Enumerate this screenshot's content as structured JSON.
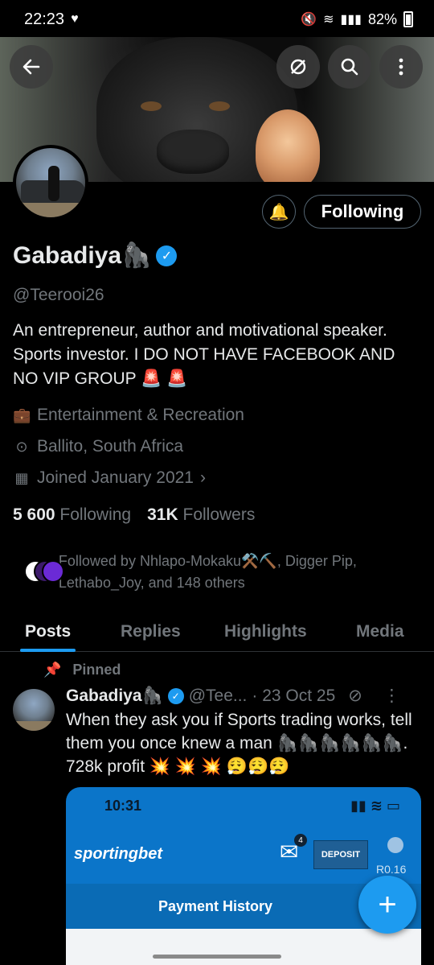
{
  "status_bar": {
    "time": "22:23",
    "battery": "82%",
    "signal_label": "Vo) LTE2"
  },
  "profile": {
    "display_name": "Gabadiya🦍",
    "handle": "@Teerooi26",
    "bio": "An entrepreneur, author and motivational speaker. Sports investor. I DO NOT HAVE FACEBOOK AND NO VIP GROUP 🚨 🚨",
    "category": "Entertainment & Recreation",
    "location": "Ballito, South Africa",
    "joined": "Joined January 2021",
    "following_count": "5 600",
    "following_label": "Following",
    "followers_count": "31K",
    "followers_label": "Followers",
    "followed_by": "Followed by Nhlapo-Mokaku⚒️⛏️, Digger Pip, Lethabo_Joy, and 148 others",
    "follow_button": "Following"
  },
  "tabs": [
    "Posts",
    "Replies",
    "Highlights",
    "Media"
  ],
  "pinned_label": "Pinned",
  "tweet": {
    "name": "Gabadiya🦍",
    "handle": "@Tee...",
    "date": "· 23 Oct 25",
    "text": "When they ask you if Sports trading works, tell them you once knew a man 🦍🦍🦍🦍🦍🦍. 728k profit 💥 💥 💥 😮‍💨😮‍💨😮‍💨"
  },
  "media": {
    "time": "10:31",
    "logo": "sportingbet",
    "mail_badge": "4",
    "deposit": "DEPOSIT",
    "balance": "R0.16",
    "title": "Payment History"
  },
  "colors": {
    "accent": "#1d9bf0",
    "muted": "#71767b",
    "text": "#e7e9ea"
  }
}
